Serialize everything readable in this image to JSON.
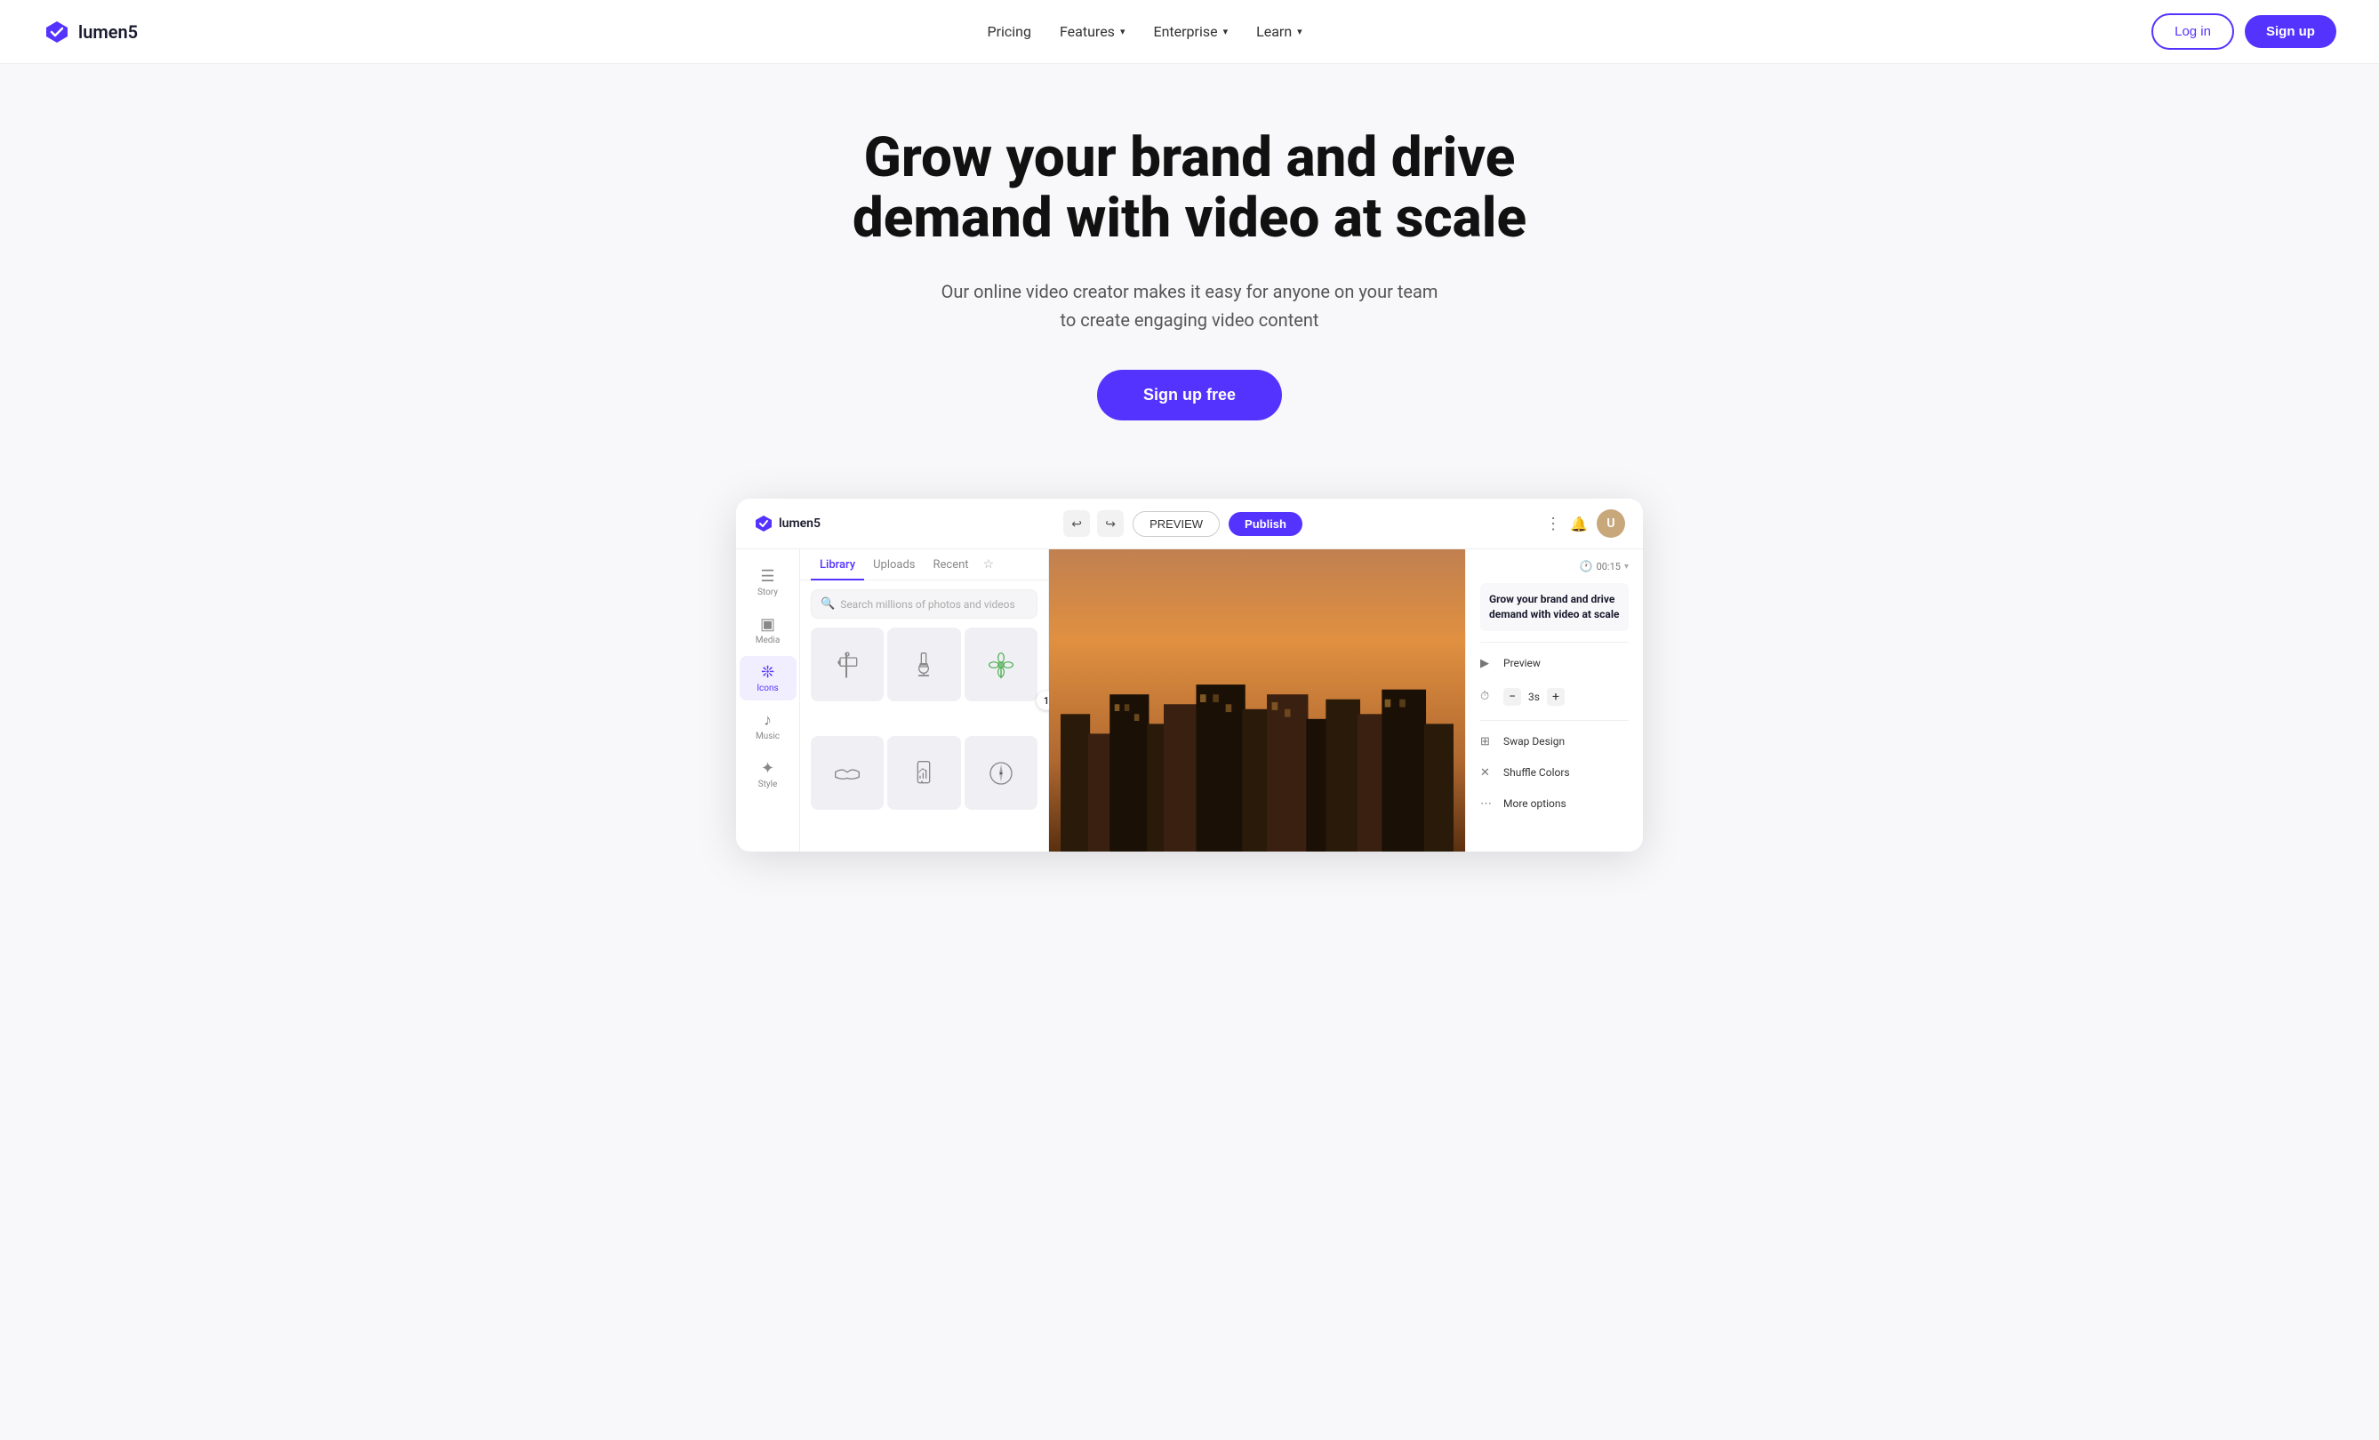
{
  "brand": {
    "name": "lumen5",
    "logo_color": "#5533ff"
  },
  "nav": {
    "links": [
      {
        "id": "pricing",
        "label": "Pricing",
        "has_dropdown": false
      },
      {
        "id": "features",
        "label": "Features",
        "has_dropdown": true
      },
      {
        "id": "enterprise",
        "label": "Enterprise",
        "has_dropdown": true
      },
      {
        "id": "learn",
        "label": "Learn",
        "has_dropdown": true
      }
    ],
    "login_label": "Log in",
    "signup_label": "Sign up"
  },
  "hero": {
    "title": "Grow your brand and drive demand with video at scale",
    "subtitle": "Our online video creator makes it easy for anyone on your team to create engaging video content",
    "cta_label": "Sign up free"
  },
  "app_preview": {
    "logo_text": "lumen5",
    "topbar": {
      "preview_label": "PREVIEW",
      "publish_label": "Publish"
    },
    "sidebar_items": [
      {
        "id": "story",
        "label": "Story",
        "icon": "≡"
      },
      {
        "id": "media",
        "label": "Media",
        "icon": "▣"
      },
      {
        "id": "icons",
        "label": "Icons",
        "icon": "❊",
        "active": true
      },
      {
        "id": "music",
        "label": "Music",
        "icon": "♪"
      },
      {
        "id": "style",
        "label": "Style",
        "icon": "✦"
      }
    ],
    "media_panel": {
      "tabs": [
        "Library",
        "Uploads",
        "Recent"
      ],
      "active_tab": "Library",
      "search_placeholder": "Search millions of photos and videos"
    },
    "right_panel": {
      "time": "00:15",
      "slide_text": "Grow your brand and drive demand with video at scale",
      "actions": [
        {
          "id": "preview",
          "icon": "▶",
          "label": "Preview"
        },
        {
          "id": "duration",
          "icon": "⏱",
          "label": "- 3s +"
        },
        {
          "id": "swap-design",
          "icon": "⊞",
          "label": "Swap Design"
        },
        {
          "id": "shuffle-colors",
          "icon": "✕",
          "label": "Shuffle Colors"
        },
        {
          "id": "more-options",
          "icon": "⋯",
          "label": "More options"
        }
      ]
    },
    "slide_number": "1"
  }
}
